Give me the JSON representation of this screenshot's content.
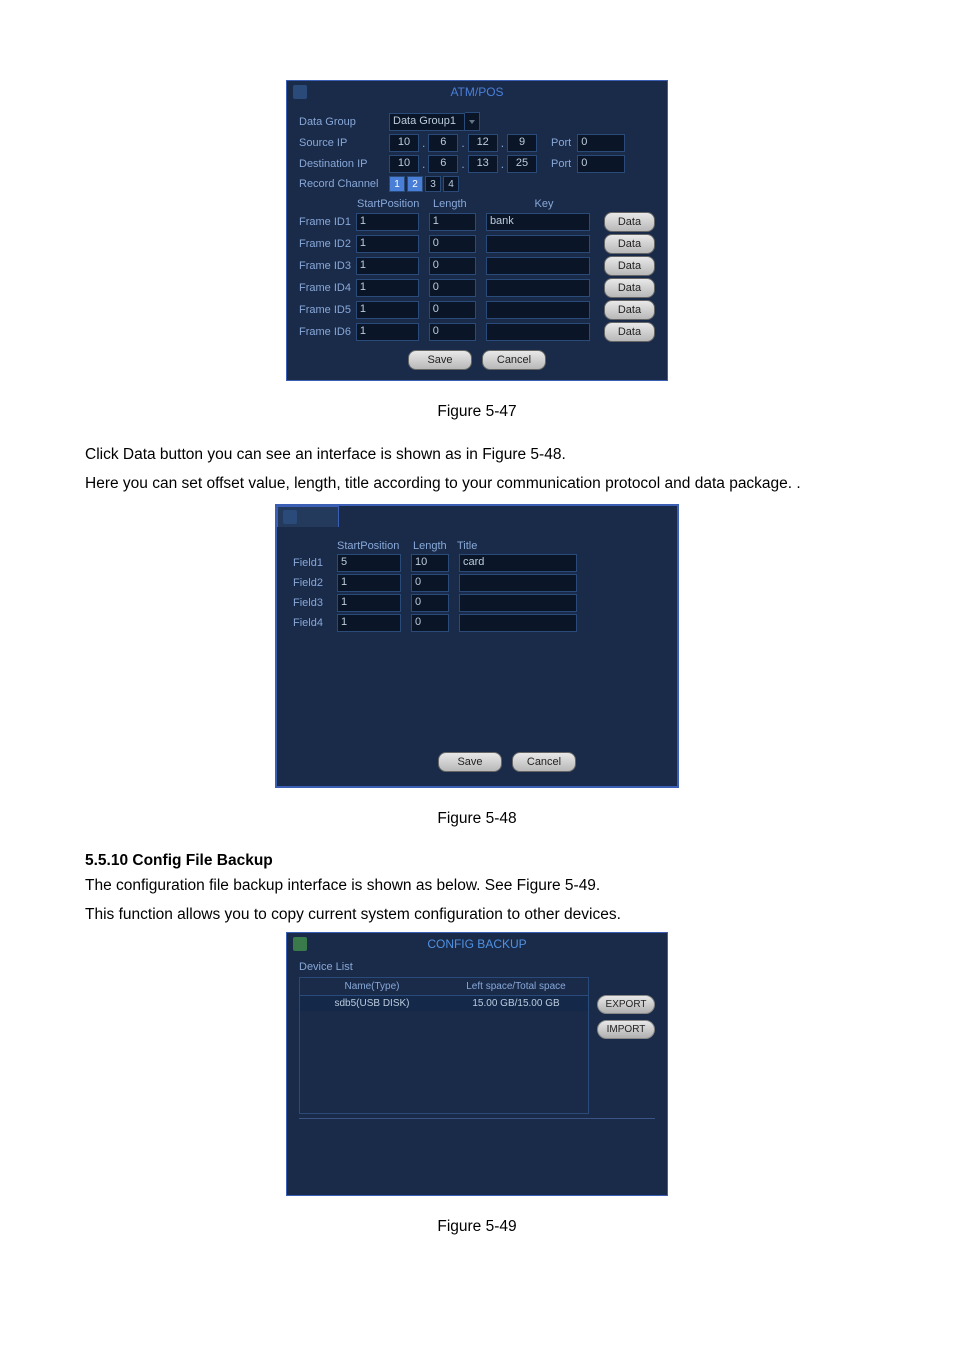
{
  "fig1": {
    "title": "ATM/POS",
    "labels": {
      "data_group": "Data Group",
      "source_ip": "Source IP",
      "dest_ip": "Destination IP",
      "record_channel": "Record Channel",
      "port": "Port"
    },
    "data_group_value": "Data Group1",
    "source_ip_parts": [
      "10",
      "6",
      "12",
      "9"
    ],
    "source_port": "0",
    "dest_ip_parts": [
      "10",
      "6",
      "13",
      "25"
    ],
    "dest_port": "0",
    "channels": [
      {
        "n": "1",
        "on": true
      },
      {
        "n": "2",
        "on": true
      },
      {
        "n": "3",
        "on": false
      },
      {
        "n": "4",
        "on": false
      }
    ],
    "headers": {
      "sp": "StartPosition",
      "len": "Length",
      "key": "Key"
    },
    "frames": [
      {
        "label": "Frame ID1",
        "sp": "1",
        "len": "1",
        "key": "bank"
      },
      {
        "label": "Frame ID2",
        "sp": "1",
        "len": "0",
        "key": ""
      },
      {
        "label": "Frame ID3",
        "sp": "1",
        "len": "0",
        "key": ""
      },
      {
        "label": "Frame ID4",
        "sp": "1",
        "len": "0",
        "key": ""
      },
      {
        "label": "Frame ID5",
        "sp": "1",
        "len": "0",
        "key": ""
      },
      {
        "label": "Frame ID6",
        "sp": "1",
        "len": "0",
        "key": ""
      }
    ],
    "data_btn": "Data",
    "save": "Save",
    "cancel": "Cancel"
  },
  "caption1": "Figure 5-47",
  "para1": "Click Data button you can see an interface is shown as in Figure 5-48.",
  "para2": "Here you can set offset value, length, title according to your communication protocol and data package. .",
  "fig2": {
    "headers": {
      "sp": "StartPosition",
      "len": "Length",
      "title": "Title"
    },
    "fields": [
      {
        "label": "Field1",
        "sp": "5",
        "len": "10",
        "title": "card"
      },
      {
        "label": "Field2",
        "sp": "1",
        "len": "0",
        "title": ""
      },
      {
        "label": "Field3",
        "sp": "1",
        "len": "0",
        "title": ""
      },
      {
        "label": "Field4",
        "sp": "1",
        "len": "0",
        "title": ""
      }
    ],
    "save": "Save",
    "cancel": "Cancel"
  },
  "caption2": "Figure 5-48",
  "section_head": "5.5.10 Config File Backup",
  "para3": "The configuration file backup interface is shown as below. See Figure 5-49.",
  "para4": "This function allows you to copy current system configuration to other devices.",
  "fig3": {
    "title": "CONFIG BACKUP",
    "device_list": "Device List",
    "col1": "Name(Type)",
    "col2": "Left space/Total space",
    "row1a": "sdb5(USB DISK)",
    "row1b": "15.00 GB/15.00 GB",
    "export": "EXPORT",
    "import": "IMPORT"
  },
  "caption3": "Figure 5-49"
}
